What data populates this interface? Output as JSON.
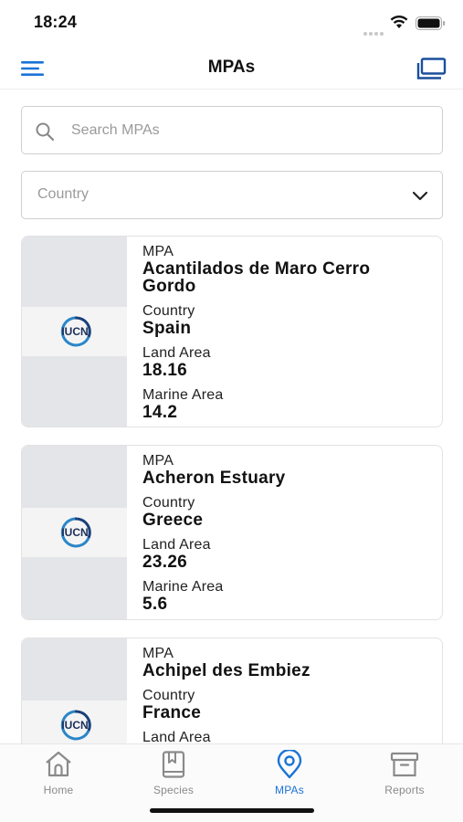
{
  "status_bar": {
    "time": "18:24"
  },
  "header": {
    "title": "MPAs"
  },
  "search": {
    "placeholder": "Search MPAs"
  },
  "country_filter": {
    "placeholder": "Country"
  },
  "labels": {
    "mpa": "MPA",
    "country": "Country",
    "land_area": "Land Area",
    "marine_area": "Marine Area"
  },
  "logo_text": "IUCN",
  "mpas": [
    {
      "name_line1": "Acantilados de Maro Cerro",
      "name_line2": "Gordo",
      "country": "Spain",
      "land_area": "18.16",
      "marine_area": "14.2"
    },
    {
      "name_line1": "Acheron Estuary",
      "country": "Greece",
      "land_area": "23.26",
      "marine_area": "5.6"
    },
    {
      "name_line1": "Achipel des Embiez",
      "country": "France",
      "land_area": "",
      "marine_area": ""
    }
  ],
  "tabs": [
    {
      "label": "Home",
      "icon": "home-icon",
      "active": false
    },
    {
      "label": "Species",
      "icon": "book-icon",
      "active": false
    },
    {
      "label": "MPAs",
      "icon": "location-pin-icon",
      "active": true
    },
    {
      "label": "Reports",
      "icon": "archive-box-icon",
      "active": false
    }
  ],
  "colors": {
    "accent": "#1a74d6",
    "inactive": "#8a8a8a",
    "thumb_bg": "#e4e5e8"
  }
}
